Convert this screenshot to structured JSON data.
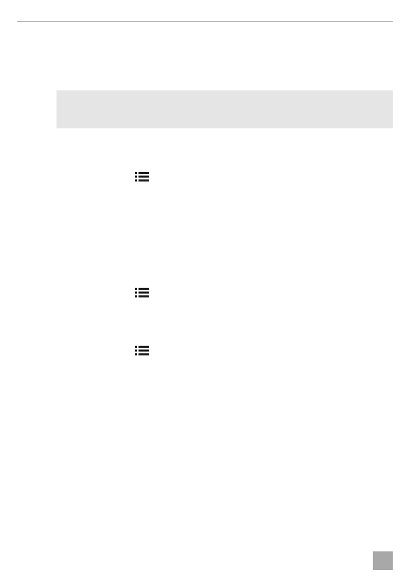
{
  "page": {
    "colors": {
      "rule": "#9b9b9b",
      "note_background": "#e5e5e5",
      "icon": "#1a1a1a",
      "page_tab": "#a8a8a8"
    }
  },
  "icons": [
    {
      "name": "list-icon"
    },
    {
      "name": "list-icon"
    },
    {
      "name": "list-icon"
    }
  ]
}
